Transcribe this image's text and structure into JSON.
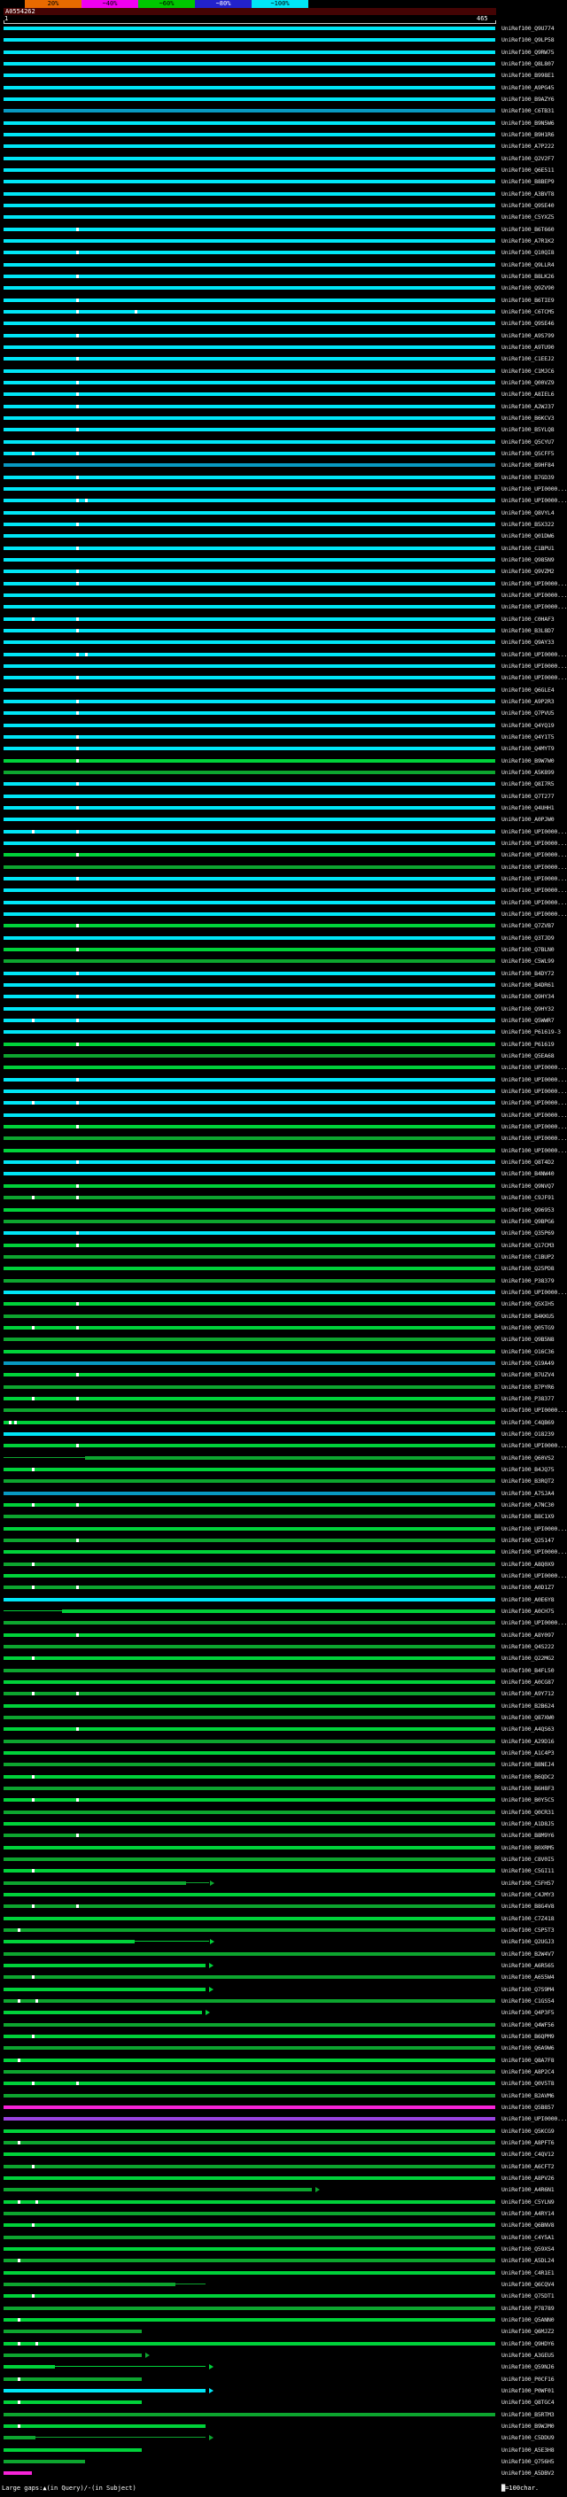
{
  "scale": {
    "segments": [
      {
        "label": "",
        "color": "#000000",
        "text": "#ffffff",
        "w": 24
      },
      {
        "label": "20%",
        "color": "#e86a00",
        "text": "#000000",
        "w": 64
      },
      {
        "label": "~40%",
        "color": "#f000f0",
        "text": "#000000",
        "w": 64
      },
      {
        "label": "~60%",
        "color": "#00c800",
        "text": "#000000",
        "w": 64
      },
      {
        "label": "~80%",
        "color": "#2222cc",
        "text": "#ffffff",
        "w": 64
      },
      {
        "label": "~100%",
        "color": "#00e6f6",
        "text": "#000000",
        "w": 64
      }
    ]
  },
  "query": {
    "name": "A0554262",
    "ruler_start": "1",
    "ruler_end": "465"
  },
  "legend": {
    "gaps": "Large gaps:▲(in Query)/-(in Subject)",
    "block": "█",
    "scale_text": "=100char."
  },
  "colors": {
    "c": "#00e6f6",
    "d": "#0899c2",
    "g": "#00d23a",
    "G": "#0da52f",
    "m": "#f724d8",
    "p": "#9b43e0"
  },
  "rows": [
    {
      "l": "UniRef100_Q9U774",
      "c": "c"
    },
    {
      "l": "UniRef100_Q9LP58",
      "c": "c"
    },
    {
      "l": "UniRef100_Q9RW75",
      "c": "c"
    },
    {
      "l": "UniRef100_Q8L807",
      "c": "c"
    },
    {
      "l": "UniRef100_B998E1",
      "c": "c"
    },
    {
      "l": "UniRef100_A9PG45",
      "c": "c"
    },
    {
      "l": "UniRef100_B9AZY6",
      "c": "c"
    },
    {
      "l": "UniRef100_C6TB31",
      "c": "d"
    },
    {
      "l": "UniRef100_B9N5W6",
      "c": "c"
    },
    {
      "l": "UniRef100_B9H1R6",
      "c": "c"
    },
    {
      "l": "UniRef100_A7P222",
      "c": "c"
    },
    {
      "l": "UniRef100_Q2V2F7",
      "c": "c"
    },
    {
      "l": "UniRef100_Q6E511",
      "c": "c"
    },
    {
      "l": "UniRef100_B8BEP9",
      "c": "c"
    },
    {
      "l": "UniRef100_A3BVT8",
      "c": "c"
    },
    {
      "l": "UniRef100_Q9SE40",
      "c": "c"
    },
    {
      "l": "UniRef100_C5YXZ5",
      "c": "c"
    },
    {
      "l": "UniRef100_B6T660",
      "c": "c",
      "m": [
        86
      ]
    },
    {
      "l": "UniRef100_A7R1K2",
      "c": "c"
    },
    {
      "l": "UniRef100_Q10QI8",
      "c": "c",
      "m": [
        86
      ]
    },
    {
      "l": "UniRef100_Q9LLR4",
      "c": "c"
    },
    {
      "l": "UniRef100_B8LK26",
      "c": "c",
      "m": [
        86
      ]
    },
    {
      "l": "UniRef100_Q9ZV90",
      "c": "c"
    },
    {
      "l": "UniRef100_B6TIE9",
      "c": "c",
      "m": [
        86
      ]
    },
    {
      "l": "UniRef100_C6TCM5",
      "c": "c",
      "m": [
        86,
        152
      ]
    },
    {
      "l": "UniRef100_Q9SE46",
      "c": "c"
    },
    {
      "l": "UniRef100_A9S799",
      "c": "c",
      "m": [
        86
      ]
    },
    {
      "l": "UniRef100_A9TU90",
      "c": "c"
    },
    {
      "l": "UniRef100_C1EEJ2",
      "c": "c",
      "m": [
        86
      ]
    },
    {
      "l": "UniRef100_C1MJC6",
      "c": "c"
    },
    {
      "l": "UniRef100_Q00VZ9",
      "c": "c",
      "m": [
        86
      ]
    },
    {
      "l": "UniRef100_A8IEL6",
      "c": "c",
      "m": [
        86
      ]
    },
    {
      "l": "UniRef100_A2WJ37",
      "c": "c",
      "m": [
        86
      ]
    },
    {
      "l": "UniRef100_B6KCV3",
      "c": "c"
    },
    {
      "l": "UniRef100_B5YLQ8",
      "c": "c",
      "m": [
        86
      ]
    },
    {
      "l": "UniRef100_Q5CYU7",
      "c": "c"
    },
    {
      "l": "UniRef100_Q5CFF5",
      "c": "c",
      "m": [
        36,
        86
      ]
    },
    {
      "l": "UniRef100_B9HF84",
      "c": "d"
    },
    {
      "l": "UniRef100_B7GD39",
      "c": "c",
      "m": [
        86
      ]
    },
    {
      "l": "UniRef100_UPI0000...",
      "c": "c"
    },
    {
      "l": "UniRef100_UPI0000...",
      "c": "c",
      "m": [
        86,
        96
      ]
    },
    {
      "l": "UniRef100_Q8VYL4",
      "c": "c"
    },
    {
      "l": "UniRef100_B5X322",
      "c": "c",
      "m": [
        86
      ]
    },
    {
      "l": "UniRef100_Q01DW6",
      "c": "c"
    },
    {
      "l": "UniRef100_C1BPU1",
      "c": "c",
      "m": [
        86
      ]
    },
    {
      "l": "UniRef100_Q985N9",
      "c": "c"
    },
    {
      "l": "UniRef100_Q9VZM2",
      "c": "c",
      "m": [
        86
      ]
    },
    {
      "l": "UniRef100_UPI0000...",
      "c": "c",
      "m": [
        86
      ]
    },
    {
      "l": "UniRef100_UPI0000...",
      "c": "c"
    },
    {
      "l": "UniRef100_UPI0000...",
      "c": "c"
    },
    {
      "l": "UniRef100_C0HAF3",
      "c": "c",
      "m": [
        36,
        86
      ]
    },
    {
      "l": "UniRef100_B3L8D7",
      "c": "c",
      "m": [
        86
      ]
    },
    {
      "l": "UniRef100_Q9AY33",
      "c": "c"
    },
    {
      "l": "UniRef100_UPI0000...",
      "c": "c",
      "m": [
        86,
        96
      ]
    },
    {
      "l": "UniRef100_UPI0000...",
      "c": "c"
    },
    {
      "l": "UniRef100_UPI0000...",
      "c": "c",
      "m": [
        86
      ]
    },
    {
      "l": "UniRef100_Q6GLE4",
      "c": "c"
    },
    {
      "l": "UniRef100_A9P2R3",
      "c": "c",
      "m": [
        86
      ]
    },
    {
      "l": "UniRef100_Q7PVU5",
      "c": "c",
      "m": [
        86
      ]
    },
    {
      "l": "UniRef100_Q4YQ19",
      "c": "c"
    },
    {
      "l": "UniRef100_Q4Y1T5",
      "c": "c",
      "m": [
        86
      ]
    },
    {
      "l": "UniRef100_Q4MYT9",
      "c": "c",
      "m": [
        86
      ]
    },
    {
      "l": "UniRef100_B9W7W0",
      "c": "g",
      "m": [
        86
      ]
    },
    {
      "l": "UniRef100_A5K899",
      "c": "G"
    },
    {
      "l": "UniRef100_Q8I7R5",
      "c": "c",
      "m": [
        86
      ]
    },
    {
      "l": "UniRef100_Q7T277",
      "c": "c"
    },
    {
      "l": "UniRef100_Q4UHH1",
      "c": "c",
      "m": [
        86
      ]
    },
    {
      "l": "UniRef100_A0PJW0",
      "c": "c"
    },
    {
      "l": "UniRef100_UPI0000...",
      "c": "c",
      "m": [
        36,
        86
      ]
    },
    {
      "l": "UniRef100_UPI0000...",
      "c": "c"
    },
    {
      "l": "UniRef100_UPI0000...",
      "c": "g",
      "m": [
        86
      ]
    },
    {
      "l": "UniRef100_UPI0000...",
      "c": "G"
    },
    {
      "l": "UniRef100_UPI0000...",
      "c": "c",
      "m": [
        86
      ]
    },
    {
      "l": "UniRef100_UPI0000...",
      "c": "c"
    },
    {
      "l": "UniRef100_UPI0000...",
      "c": "c"
    },
    {
      "l": "UniRef100_UPI0000...",
      "c": "c"
    },
    {
      "l": "UniRef100_Q7ZVB7",
      "c": "g",
      "m": [
        86
      ]
    },
    {
      "l": "UniRef100_Q3TJD9",
      "c": "c"
    },
    {
      "l": "UniRef100_Q7BLN0",
      "c": "g",
      "m": [
        86
      ]
    },
    {
      "l": "UniRef100_C5WL99",
      "c": "G"
    },
    {
      "l": "UniRef100_B4DY72",
      "c": "c",
      "m": [
        86
      ]
    },
    {
      "l": "UniRef100_B4DR61",
      "c": "c"
    },
    {
      "l": "UniRef100_Q9HY34",
      "c": "c",
      "m": [
        86
      ]
    },
    {
      "l": "UniRef100_Q9HY32",
      "c": "c"
    },
    {
      "l": "UniRef100_Q5WWR7",
      "c": "c",
      "m": [
        36,
        86
      ]
    },
    {
      "l": "UniRef100_P61619-3",
      "c": "c"
    },
    {
      "l": "UniRef100_P61619",
      "c": "g",
      "m": [
        86
      ]
    },
    {
      "l": "UniRef100_Q5EA68",
      "c": "G"
    },
    {
      "l": "UniRef100_UPI0000...",
      "c": "g"
    },
    {
      "l": "UniRef100_UPI0000...",
      "c": "c",
      "m": [
        86
      ]
    },
    {
      "l": "UniRef100_UPI0000...",
      "c": "c"
    },
    {
      "l": "UniRef100_UPI0000...",
      "c": "c",
      "m": [
        36,
        86
      ]
    },
    {
      "l": "UniRef100_UPI0000...",
      "c": "c"
    },
    {
      "l": "UniRef100_UPI0000...",
      "c": "g",
      "m": [
        86
      ]
    },
    {
      "l": "UniRef100_UPI0000...",
      "c": "G"
    },
    {
      "l": "UniRef100_UPI0000...",
      "c": "g"
    },
    {
      "l": "UniRef100_Q8T4D2",
      "c": "c",
      "m": [
        86
      ]
    },
    {
      "l": "UniRef100_B4NW40",
      "c": "c"
    },
    {
      "l": "UniRef100_Q9NVQ7",
      "c": "g",
      "m": [
        86
      ]
    },
    {
      "l": "UniRef100_C9JF91",
      "c": "G",
      "m": [
        36,
        86
      ]
    },
    {
      "l": "UniRef100_Q96953",
      "c": "g"
    },
    {
      "l": "UniRef100_Q9BPG6",
      "c": "G"
    },
    {
      "l": "UniRef100_Q35P69",
      "c": "c",
      "m": [
        86
      ]
    },
    {
      "l": "UniRef100_Q17CM3",
      "c": "g",
      "m": [
        86
      ]
    },
    {
      "l": "UniRef100_C1BUP2",
      "c": "G"
    },
    {
      "l": "UniRef100_Q25PD8",
      "c": "g"
    },
    {
      "l": "UniRef100_P38379",
      "c": "G"
    },
    {
      "l": "UniRef100_UPI0000...",
      "c": "c"
    },
    {
      "l": "UniRef100_Q5XIH5",
      "c": "g",
      "m": [
        86
      ]
    },
    {
      "l": "UniRef100_B4KKU5",
      "c": "G"
    },
    {
      "l": "UniRef100_Q05TG9",
      "c": "g",
      "m": [
        36,
        86
      ]
    },
    {
      "l": "UniRef100_Q9B5N8",
      "c": "G"
    },
    {
      "l": "UniRef100_O16C36",
      "c": "g"
    },
    {
      "l": "UniRef100_Q19A49",
      "c": "d"
    },
    {
      "l": "UniRef100_B7UZV4",
      "c": "g",
      "m": [
        86
      ]
    },
    {
      "l": "UniRef100_B7PYR6",
      "c": "G"
    },
    {
      "l": "UniRef100_P38377",
      "c": "g",
      "m": [
        36,
        86
      ]
    },
    {
      "l": "UniRef100_UPI0000...",
      "c": "G"
    },
    {
      "l": "UniRef100_C4QB69",
      "c": "g",
      "m": [
        10,
        16
      ]
    },
    {
      "l": "UniRef100_O18239",
      "c": "c"
    },
    {
      "l": "UniRef100_UPI0000...",
      "c": "g",
      "m": [
        86
      ]
    },
    {
      "l": "UniRef100_Q60VS2",
      "c": "G",
      "s": 96,
      "t": [
        [
          4,
          96
        ]
      ]
    },
    {
      "l": "UniRef100_B4JQ75",
      "c": "g",
      "m": [
        36
      ]
    },
    {
      "l": "UniRef100_B3RQT2",
      "c": "G"
    },
    {
      "l": "UniRef100_A7SJA4",
      "c": "d"
    },
    {
      "l": "UniRef100_A7NC30",
      "c": "g",
      "m": [
        36,
        86
      ]
    },
    {
      "l": "UniRef100_B8C1X9",
      "c": "G"
    },
    {
      "l": "UniRef100_UPI0000...",
      "c": "g"
    },
    {
      "l": "UniRef100_Q25147",
      "c": "G",
      "m": [
        86
      ]
    },
    {
      "l": "UniRef100_UPI0000...",
      "c": "g"
    },
    {
      "l": "UniRef100_A8Q0X9",
      "c": "G",
      "m": [
        36
      ]
    },
    {
      "l": "UniRef100_UPI0000...",
      "c": "g"
    },
    {
      "l": "UniRef100_A0D1Z7",
      "c": "G",
      "m": [
        36,
        86
      ]
    },
    {
      "l": "UniRef100_A0E6Y8",
      "c": "c"
    },
    {
      "l": "UniRef100_A0CH75",
      "c": "g",
      "s": 70,
      "t": [
        [
          4,
          70
        ]
      ]
    },
    {
      "l": "UniRef100_UPI0000...",
      "c": "G"
    },
    {
      "l": "UniRef100_A8Y097",
      "c": "g",
      "m": [
        86
      ]
    },
    {
      "l": "UniRef100_Q4S222",
      "c": "G"
    },
    {
      "l": "UniRef100_Q22MG2",
      "c": "g",
      "m": [
        36
      ]
    },
    {
      "l": "UniRef100_B4FL50",
      "c": "G"
    },
    {
      "l": "UniRef100_A0CG87",
      "c": "g"
    },
    {
      "l": "UniRef100_A9Y712",
      "c": "G",
      "m": [
        36,
        86
      ]
    },
    {
      "l": "UniRef100_B2B624",
      "c": "g"
    },
    {
      "l": "UniRef100_Q87XW0",
      "c": "G"
    },
    {
      "l": "UniRef100_A4QS63",
      "c": "g",
      "m": [
        86
      ]
    },
    {
      "l": "UniRef100_A29D16",
      "c": "G"
    },
    {
      "l": "UniRef100_A1C4P3",
      "c": "g"
    },
    {
      "l": "UniRef100_B8NEJ4",
      "c": "G"
    },
    {
      "l": "UniRef100_B6QDC2",
      "c": "g",
      "m": [
        36
      ]
    },
    {
      "l": "UniRef100_B6H8F3",
      "c": "G"
    },
    {
      "l": "UniRef100_B0Y5C5",
      "c": "g",
      "m": [
        36,
        86
      ]
    },
    {
      "l": "UniRef100_Q0CR31",
      "c": "G"
    },
    {
      "l": "UniRef100_A1D8J5",
      "c": "g"
    },
    {
      "l": "UniRef100_B8M9Y6",
      "c": "G",
      "m": [
        86
      ]
    },
    {
      "l": "UniRef100_B0XRM5",
      "c": "g"
    },
    {
      "l": "UniRef100_C8V0I5",
      "c": "G"
    },
    {
      "l": "UniRef100_C5GI11",
      "c": "g",
      "m": [
        36
      ]
    },
    {
      "l": "UniRef100_C5FH57",
      "c": "G",
      "e": 210,
      "t": [
        [
          210,
          236
        ]
      ],
      "a": 237
    },
    {
      "l": "UniRef100_C4JMY3",
      "c": "g"
    },
    {
      "l": "UniRef100_B8G4V8",
      "c": "G",
      "m": [
        36,
        86
      ]
    },
    {
      "l": "UniRef100_C7Z418",
      "c": "g"
    },
    {
      "l": "UniRef100_C5P5T3",
      "c": "G",
      "m": [
        20
      ]
    },
    {
      "l": "UniRef100_Q2UGJ3",
      "c": "g",
      "e": 152,
      "t": [
        [
          152,
          236
        ]
      ],
      "a": 237
    },
    {
      "l": "UniRef100_B2W4V7",
      "c": "G"
    },
    {
      "l": "UniRef100_A6R565",
      "c": "g",
      "e": 232,
      "a": 236
    },
    {
      "l": "UniRef100_A6S5W4",
      "c": "G",
      "m": [
        36
      ]
    },
    {
      "l": "UniRef100_Q7S9M4",
      "c": "g",
      "e": 232,
      "a": 236
    },
    {
      "l": "UniRef100_C1GS54",
      "c": "G",
      "m": [
        20,
        40
      ]
    },
    {
      "l": "UniRef100_Q4P3F5",
      "c": "g",
      "e": 228,
      "a": 232
    },
    {
      "l": "UniRef100_Q4WF56",
      "c": "G"
    },
    {
      "l": "UniRef100_B6QPM9",
      "c": "g",
      "m": [
        36
      ]
    },
    {
      "l": "UniRef100_Q6A9W6",
      "c": "G"
    },
    {
      "l": "UniRef100_Q8A7F8",
      "c": "g",
      "m": [
        20
      ]
    },
    {
      "l": "UniRef100_A8P2C4",
      "c": "G"
    },
    {
      "l": "UniRef100_Q0V5T8",
      "c": "g",
      "m": [
        36,
        86
      ]
    },
    {
      "l": "UniRef100_B2AVM6",
      "c": "G"
    },
    {
      "l": "UniRef100_Q5B857",
      "c": "m"
    },
    {
      "l": "UniRef100_UPI0000...",
      "c": "p"
    },
    {
      "l": "UniRef100_Q5KCG9",
      "c": "g"
    },
    {
      "l": "UniRef100_A8PFT6",
      "c": "G",
      "m": [
        20
      ]
    },
    {
      "l": "UniRef100_C4QV12",
      "c": "g"
    },
    {
      "l": "UniRef100_A6CFT2",
      "c": "G",
      "m": [
        36
      ]
    },
    {
      "l": "UniRef100_A8PV26",
      "c": "g"
    },
    {
      "l": "UniRef100_A4R6N1",
      "c": "G",
      "e": 352,
      "a": 356
    },
    {
      "l": "UniRef100_C5YLN9",
      "c": "g",
      "m": [
        20,
        40
      ]
    },
    {
      "l": "UniRef100_A4RY14",
      "c": "G"
    },
    {
      "l": "UniRef100_Q6BNV8",
      "c": "g",
      "m": [
        36
      ]
    },
    {
      "l": "UniRef100_C4Y5A1",
      "c": "G"
    },
    {
      "l": "UniRef100_Q59XS4",
      "c": "g"
    },
    {
      "l": "UniRef100_A5DL24",
      "c": "G",
      "m": [
        20
      ]
    },
    {
      "l": "UniRef100_C4R1E1",
      "c": "g"
    },
    {
      "l": "UniRef100_Q6CQV4",
      "c": "G",
      "e": 198,
      "t": [
        [
          198,
          232
        ]
      ]
    },
    {
      "l": "UniRef100_Q75DT1",
      "c": "g",
      "m": [
        36
      ]
    },
    {
      "l": "UniRef100_P78789",
      "c": "G"
    },
    {
      "l": "UniRef100_Q5ANN0",
      "c": "g",
      "m": [
        20
      ]
    },
    {
      "l": "UniRef100_Q6MJZ2",
      "c": "G",
      "e": 160
    },
    {
      "l": "UniRef100_Q9HDY6",
      "c": "g",
      "m": [
        20,
        40
      ]
    },
    {
      "l": "UniRef100_A3GEU5",
      "c": "G",
      "e": 160,
      "a": 164
    },
    {
      "l": "UniRef100_Q59NJ6",
      "c": "g",
      "e": 62,
      "t": [
        [
          62,
          232
        ]
      ],
      "a": 236
    },
    {
      "l": "UniRef100_P0CF16",
      "c": "G",
      "e": 160,
      "m": [
        20
      ]
    },
    {
      "l": "UniRef100_P0WF01",
      "c": "c",
      "e": 232,
      "a": 236
    },
    {
      "l": "UniRef100_Q8TGC4",
      "c": "g",
      "e": 160,
      "m": [
        20
      ]
    },
    {
      "l": "UniRef100_B5RTM3",
      "c": "G"
    },
    {
      "l": "UniRef100_B9WJM0",
      "c": "g",
      "e": 232,
      "m": [
        20
      ]
    },
    {
      "l": "UniRef100_C5DDU9",
      "c": "G",
      "e": 40,
      "t": [
        [
          40,
          232
        ]
      ],
      "a": 236
    },
    {
      "l": "UniRef100_A5E3H8",
      "c": "g",
      "e": 160
    },
    {
      "l": "UniRef100_Q756H5",
      "c": "G",
      "e": 96
    },
    {
      "l": "UniRef100_A5DBV2",
      "c": "m",
      "e": 36
    }
  ]
}
